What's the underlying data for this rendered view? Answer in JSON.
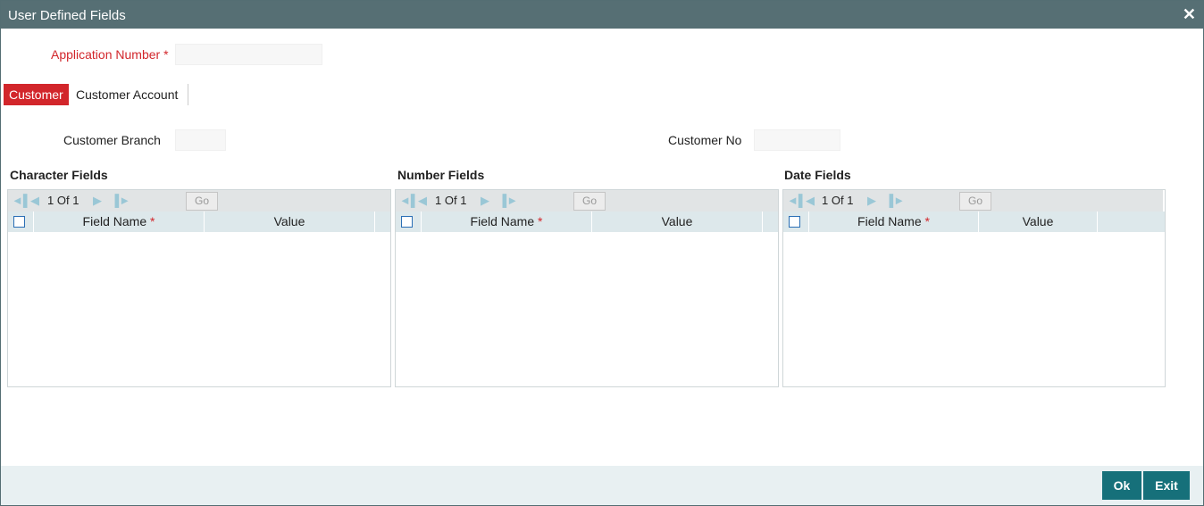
{
  "window": {
    "title": "User Defined Fields",
    "close_glyph": "✕"
  },
  "application": {
    "label": "Application Number",
    "required_mark": "*",
    "value": ""
  },
  "tabs": [
    {
      "label": "Customer",
      "active": true
    },
    {
      "label": "Customer Account",
      "active": false
    }
  ],
  "customer": {
    "branch_label": "Customer Branch",
    "branch_value": "",
    "no_label": "Customer No",
    "no_value": ""
  },
  "sections": [
    {
      "title": "Character Fields",
      "page_current": "1",
      "page_of": "Of",
      "page_total": "1",
      "go_label": "Go",
      "col_name": "Field Name",
      "col_required": "*",
      "col_value": "Value"
    },
    {
      "title": "Number Fields",
      "page_current": "1",
      "page_of": "Of",
      "page_total": "1",
      "go_label": "Go",
      "col_name": "Field Name",
      "col_required": "*",
      "col_value": "Value"
    },
    {
      "title": "Date Fields",
      "page_current": "1",
      "page_of": "Of",
      "page_total": "1",
      "go_label": "Go",
      "col_name": "Field Name",
      "col_required": "*",
      "col_value": "Value"
    }
  ],
  "pager_icons": {
    "first": "first-page-icon",
    "prev": "previous-page-icon",
    "next": "next-page-icon",
    "last": "last-page-icon"
  },
  "buttons": {
    "ok": "Ok",
    "exit": "Exit"
  },
  "colors": {
    "titlebar": "#566f74",
    "accent": "#d2262b",
    "button": "#16707a",
    "pager_icon": "#9ac7d6"
  }
}
